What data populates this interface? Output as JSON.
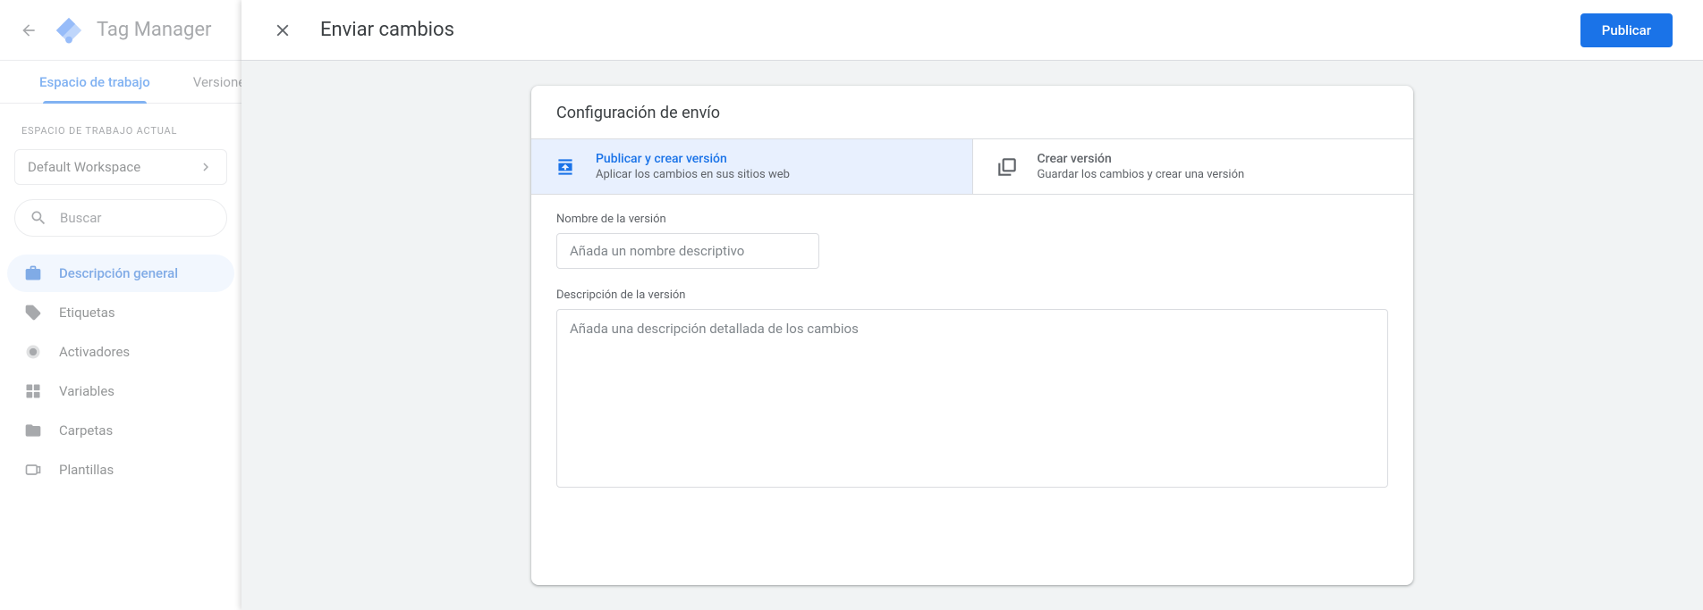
{
  "product_name": "Tag Manager",
  "tabs": {
    "workspace": "Espacio de trabajo",
    "versions": "Versiones"
  },
  "sidebar": {
    "ws_label": "ESPACIO DE TRABAJO ACTUAL",
    "ws_name": "Default Workspace",
    "search_placeholder": "Buscar",
    "items": {
      "overview": "Descripción general",
      "tags": "Etiquetas",
      "triggers": "Activadores",
      "variables": "Variables",
      "folders": "Carpetas",
      "templates": "Plantillas"
    }
  },
  "modal": {
    "title": "Enviar cambios",
    "publish_btn": "Publicar",
    "card_heading": "Configuración de envío",
    "option_publish": {
      "title": "Publicar y crear versión",
      "sub": "Aplicar los cambios en sus sitios web"
    },
    "option_version": {
      "title": "Crear versión",
      "sub": "Guardar los cambios y crear una versión"
    },
    "version_name_label": "Nombre de la versión",
    "version_name_placeholder": "Añada un nombre descriptivo",
    "version_desc_label": "Descripción de la versión",
    "version_desc_placeholder": "Añada una descripción detallada de los cambios"
  }
}
